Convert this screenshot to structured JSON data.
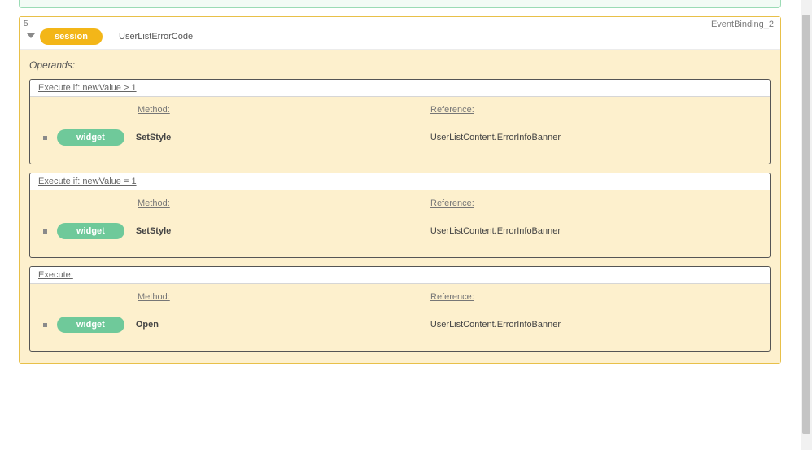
{
  "panel": {
    "index": "5",
    "right_id": "EventBinding_2",
    "session_pill": "session",
    "title": "UserListErrorCode",
    "operands_label": "Operands:"
  },
  "labels": {
    "method": "Method:",
    "reference": "Reference:"
  },
  "groups": [
    {
      "header": "Execute if: newValue > 1",
      "pill": "widget",
      "method": "SetStyle",
      "reference": "UserListContent.ErrorInfoBanner"
    },
    {
      "header": "Execute if: newValue = 1",
      "pill": "widget",
      "method": "SetStyle",
      "reference": "UserListContent.ErrorInfoBanner"
    },
    {
      "header": "Execute:",
      "pill": "widget",
      "method": "Open",
      "reference": "UserListContent.ErrorInfoBanner"
    }
  ]
}
